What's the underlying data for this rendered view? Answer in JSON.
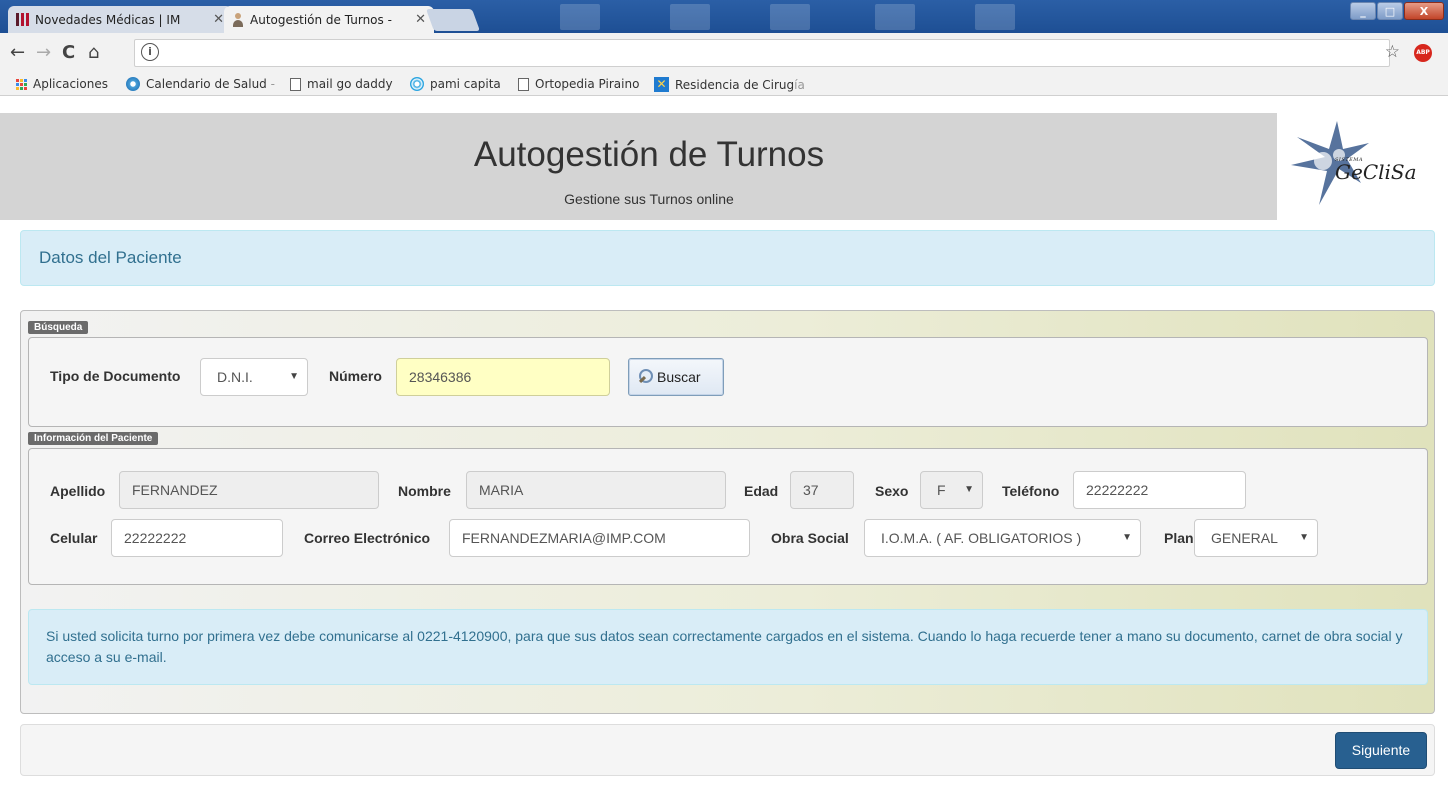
{
  "browser": {
    "tabs": [
      {
        "title": "Novedades Médicas | IM",
        "close": "✕"
      },
      {
        "title": "Autogestión de Turnos -",
        "close": "✕"
      }
    ],
    "nav": {
      "back": "←",
      "forward": "→",
      "reload": "C",
      "home": "⌂"
    },
    "address": {
      "info_icon": "i",
      "value": ""
    },
    "star": "☆",
    "abp": "ABP",
    "window_buttons": {
      "minimize": "_",
      "maximize": "□",
      "close": "X"
    },
    "bookmarks": [
      {
        "label": "Aplicaciones"
      },
      {
        "label": "Calendario de Salud",
        "fade": " -"
      },
      {
        "label": "mail go daddy"
      },
      {
        "label": "pami capita"
      },
      {
        "label": "Ortopedia Piraino"
      },
      {
        "label": "Residencia de Cirug",
        "fade": "ía"
      }
    ]
  },
  "header": {
    "title": "Autogestión de Turnos",
    "subtitle": "Gestione sus Turnos online",
    "logo_small": "SISTEMA",
    "logo_word": "GeCliSa"
  },
  "panel": {
    "heading": "Datos del Paciente"
  },
  "search": {
    "legend": "Búsqueda",
    "doc_type_label": "Tipo de Documento",
    "doc_type_value": "D.N.I.",
    "number_label": "Número",
    "number_value": "28346386",
    "button_label": "Buscar"
  },
  "patient": {
    "legend": "Información del Paciente",
    "apellido_label": "Apellido",
    "apellido_value": "FERNANDEZ",
    "nombre_label": "Nombre",
    "nombre_value": "MARIA",
    "edad_label": "Edad",
    "edad_value": "37",
    "sexo_label": "Sexo",
    "sexo_value": "F",
    "telefono_label": "Teléfono",
    "telefono_value": "22222222",
    "celular_label": "Celular",
    "celular_value": "22222222",
    "email_label": "Correo Electrónico",
    "email_value": "FERNANDEZMARIA@IMP.COM",
    "obra_social_label": "Obra Social",
    "obra_social_value": "I.O.M.A. ( AF. OBLIGATORIOS )",
    "plan_label": "Plan",
    "plan_value": "GENERAL"
  },
  "info_message": "Si usted solicita turno por primera vez debe comunicarse al 0221-4120900, para que sus datos sean correctamente cargados en el sistema. Cuando lo haga recuerde tener a mano su documento, carnet de obra social y acceso a su e-mail.",
  "footer": {
    "next_label": "Siguiente"
  },
  "colors": {
    "accent": "#286090",
    "info_bg": "#d9edf7",
    "info_text": "#31708f",
    "highlight_input": "#ffffc4"
  }
}
